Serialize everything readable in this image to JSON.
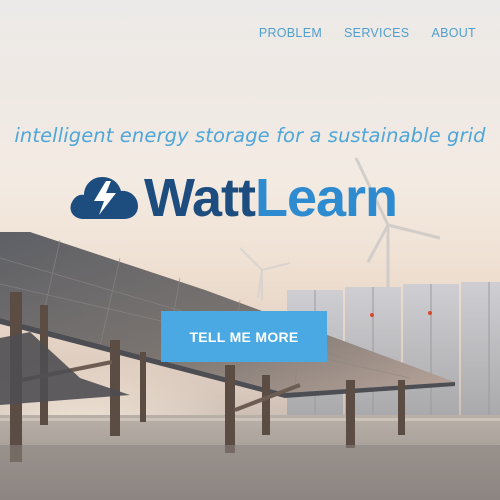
{
  "nav": {
    "items": [
      {
        "label": "PROBLEM"
      },
      {
        "label": "SERVICES"
      },
      {
        "label": "ABOUT"
      }
    ]
  },
  "hero": {
    "tagline": "intelligent energy storage for a sustainable grid",
    "brand": {
      "part1": "Watt",
      "part2": "Learn"
    },
    "cta_label": "TELL ME MORE"
  },
  "colors": {
    "nav": "#4f9fce",
    "tagline": "#4ea6d9",
    "brand_dark": "#1d4d7f",
    "brand_light": "#2e8bcf",
    "cta": "#4aa9e3"
  },
  "icons": [
    "cloud-lightning-logo-icon"
  ]
}
